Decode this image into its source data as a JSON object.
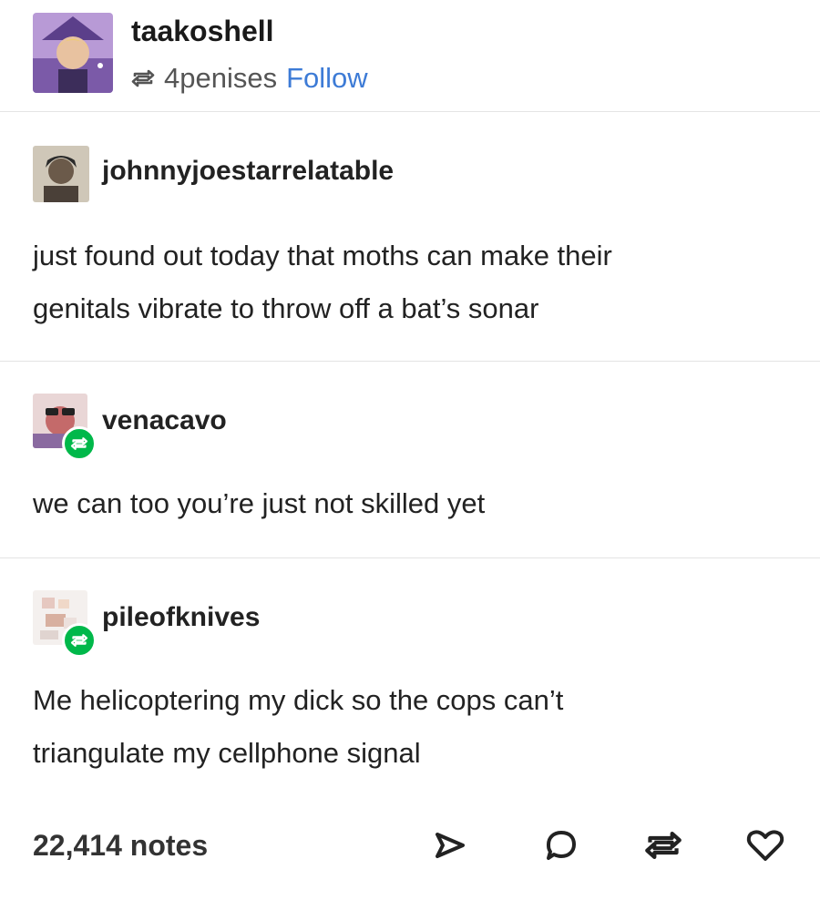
{
  "header": {
    "blog_name": "taakoshell",
    "reblog_source": "4penises",
    "follow_label": "Follow"
  },
  "posts": [
    {
      "username": "johnnyjoestarrelatable",
      "lines": [
        "just found out today that moths can make their",
        "genitals vibrate to throw off a bat’s sonar"
      ]
    },
    {
      "username": "venacavo",
      "lines": [
        "we can too you’re just not skilled yet"
      ]
    },
    {
      "username": "pileofknives",
      "lines": [
        "Me helicoptering my dick so the cops can’t",
        "triangulate my cellphone signal"
      ]
    }
  ],
  "footer": {
    "notes": "22,414 notes",
    "icons": [
      "share-icon",
      "reply-icon",
      "reblog-icon",
      "like-icon"
    ]
  },
  "colors": {
    "follow_link": "#3d7bd6",
    "reblog_badge": "#00b84a",
    "text": "#222222",
    "divider": "#e4e4e4"
  }
}
